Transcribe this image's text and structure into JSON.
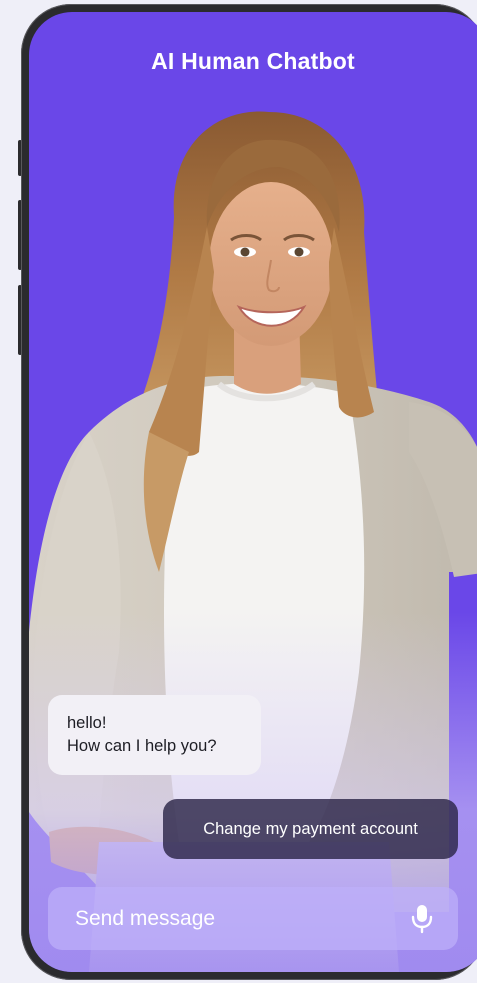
{
  "app": {
    "title": "AI Human Chatbot"
  },
  "chat": {
    "bot_message": {
      "line1": "hello!",
      "line2": "How can I help you?"
    },
    "user_message": "Change my payment account"
  },
  "composer": {
    "placeholder": "Send message",
    "mic_icon": "microphone-icon"
  },
  "colors": {
    "background": "#6a47e8",
    "bot_bubble": "#f2f0f6",
    "user_bubble": "#2c2648",
    "input_bar": "#beb0fa"
  }
}
